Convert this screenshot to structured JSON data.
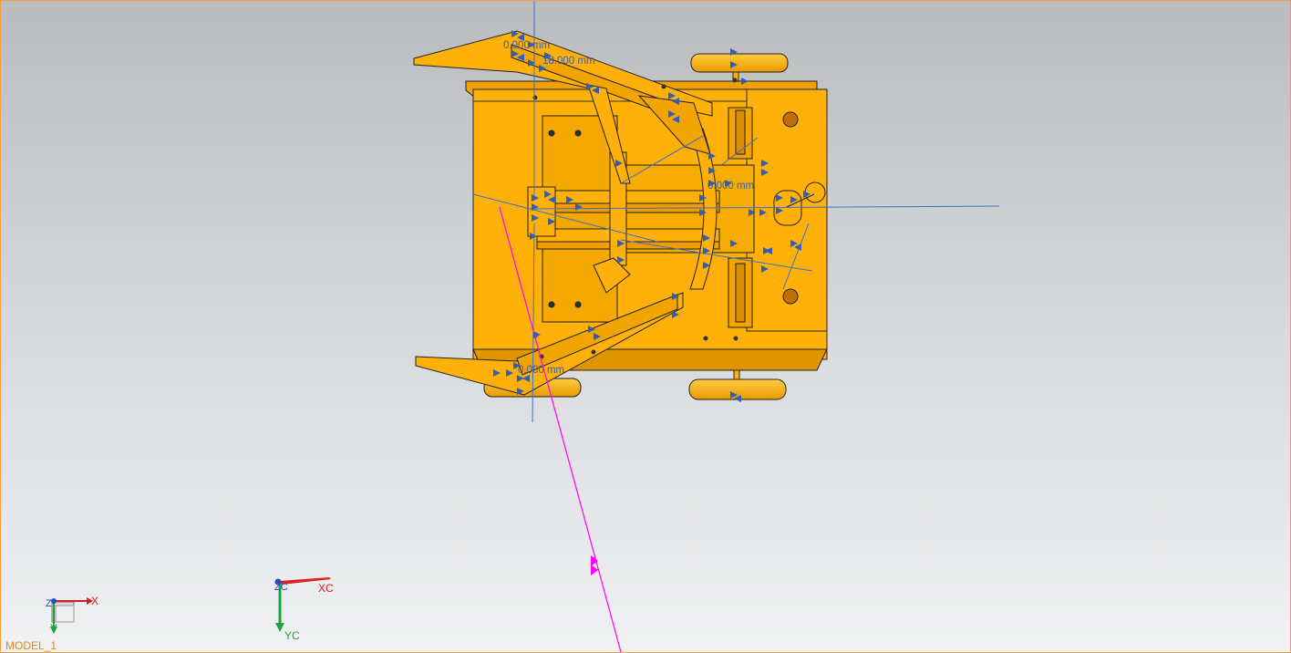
{
  "viewport": {
    "model_name": "MODEL_1",
    "background_top": "#b9bbbd",
    "background_bottom": "#f0f1f2",
    "part_color": "#ffb10a",
    "edge_color": "#1a1a1a",
    "constraint_color": "#3b5fa8",
    "highlight_color": "#ff00ff"
  },
  "dimensions": {
    "d1": "0.000 mm",
    "d2": "18.000 mm",
    "d3": "0.000 mm",
    "d4": "0.000 mm"
  },
  "triad_absolute": {
    "x_label": "X",
    "y_label": "Y",
    "z_label": "Z"
  },
  "triad_wcs": {
    "x_label": "XC",
    "y_label": "YC",
    "z_label": "ZC"
  }
}
